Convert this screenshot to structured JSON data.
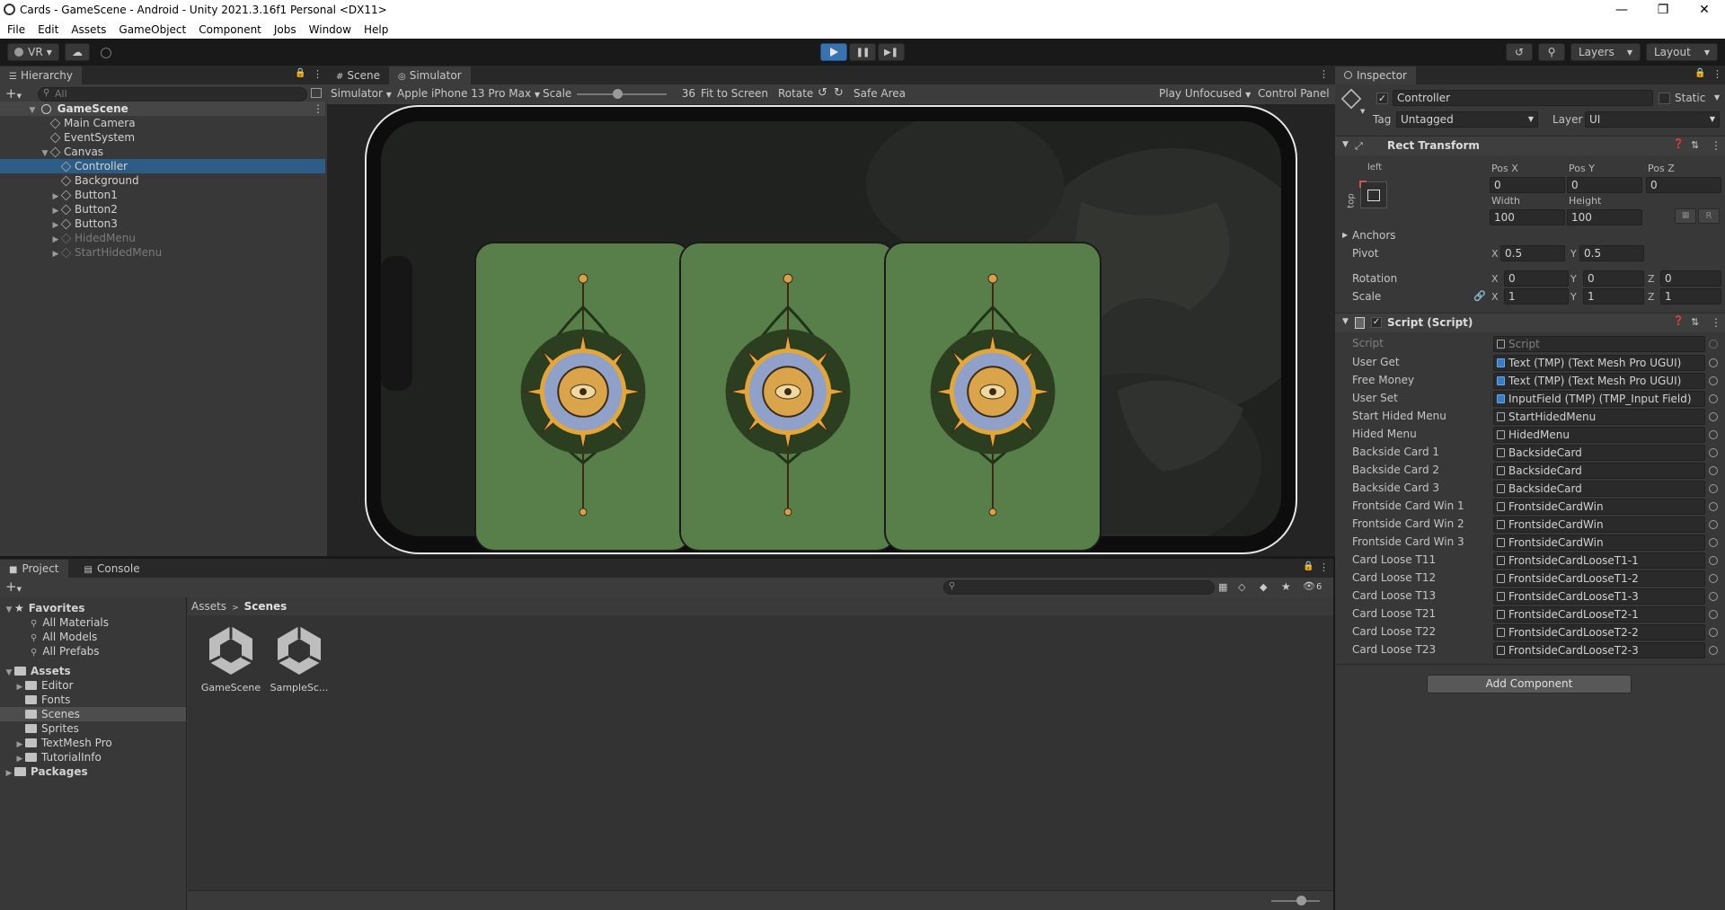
{
  "window": {
    "title": "Cards - GameScene - Android - Unity 2021.3.16f1 Personal <DX11>"
  },
  "menu": [
    "File",
    "Edit",
    "Assets",
    "GameObject",
    "Component",
    "Jobs",
    "Window",
    "Help"
  ],
  "toolbar": {
    "vr_label": "VR",
    "layers_label": "Layers",
    "layout_label": "Layout"
  },
  "hierarchy": {
    "tab": "Hierarchy",
    "search_placeholder": "All",
    "scene": "GameScene",
    "items": [
      {
        "label": "Main Camera",
        "depth": 1,
        "expandable": false,
        "selected": false,
        "dim": false
      },
      {
        "label": "EventSystem",
        "depth": 1,
        "expandable": false,
        "selected": false,
        "dim": false
      },
      {
        "label": "Canvas",
        "depth": 1,
        "expandable": true,
        "selected": false,
        "dim": false
      },
      {
        "label": "Controller",
        "depth": 2,
        "expandable": false,
        "selected": true,
        "dim": false
      },
      {
        "label": "Background",
        "depth": 2,
        "expandable": false,
        "selected": false,
        "dim": false
      },
      {
        "label": "Button1",
        "depth": 2,
        "expandable": true,
        "selected": false,
        "dim": false
      },
      {
        "label": "Button2",
        "depth": 2,
        "expandable": true,
        "selected": false,
        "dim": false
      },
      {
        "label": "Button3",
        "depth": 2,
        "expandable": true,
        "selected": false,
        "dim": false
      },
      {
        "label": "HidedMenu",
        "depth": 2,
        "expandable": true,
        "selected": false,
        "dim": true
      },
      {
        "label": "StartHidedMenu",
        "depth": 2,
        "expandable": true,
        "selected": false,
        "dim": true
      }
    ]
  },
  "scene_view": {
    "tabs": [
      "Scene",
      "Simulator"
    ],
    "simulator_label": "Simulator",
    "device": "Apple iPhone 13 Pro Max",
    "scale_label": "Scale",
    "scale_value": "36",
    "fit_label": "Fit to Screen",
    "rotate_label": "Rotate",
    "safe_area_label": "Safe Area",
    "play_unfocused_label": "Play Unfocused",
    "control_panel_label": "Control Panel",
    "scale_slider_level": 0.45
  },
  "inspector": {
    "tab": "Inspector",
    "object_name": "Controller",
    "static_label": "Static",
    "tag_label": "Tag",
    "tag_value": "Untagged",
    "layer_label": "Layer",
    "layer_value": "UI",
    "rect_transform": {
      "title": "Rect Transform",
      "anchor_h": "left",
      "anchor_v": "top",
      "posx_label": "Pos X",
      "posx": "0",
      "posy_label": "Pos Y",
      "posy": "0",
      "posz_label": "Pos Z",
      "posz": "0",
      "width_label": "Width",
      "width": "100",
      "height_label": "Height",
      "height": "100",
      "anchors_label": "Anchors",
      "pivot_label": "Pivot",
      "pivot_x": "0.5",
      "pivot_y": "0.5",
      "rotation_label": "Rotation",
      "rot_x": "0",
      "rot_y": "0",
      "rot_z": "0",
      "scale_label": "Scale",
      "scale_x": "1",
      "scale_y": "1",
      "scale_z": "1",
      "x_label": "X",
      "y_label": "Y",
      "z_label": "Z",
      "r_label": "R"
    },
    "script": {
      "title": "Script (Script)",
      "script_label": "Script",
      "script_value": "Script",
      "fields": [
        {
          "label": "User Get",
          "value": "Text (TMP) (Text Mesh Pro UGUI)",
          "kind": "tmp"
        },
        {
          "label": "Free Money",
          "value": "Text (TMP) (Text Mesh Pro UGUI)",
          "kind": "tmp"
        },
        {
          "label": "User Set",
          "value": "InputField (TMP) (TMP_Input Field)",
          "kind": "tmp"
        },
        {
          "label": "Start Hided Menu",
          "value": "StartHidedMenu",
          "kind": "obj"
        },
        {
          "label": "Hided Menu",
          "value": "HidedMenu",
          "kind": "obj"
        },
        {
          "label": "Backside Card 1",
          "value": "BacksideCard",
          "kind": "obj"
        },
        {
          "label": "Backside Card 2",
          "value": "BacksideCard",
          "kind": "obj"
        },
        {
          "label": "Backside Card 3",
          "value": "BacksideCard",
          "kind": "obj"
        },
        {
          "label": "Frontside Card Win 1",
          "value": "FrontsideCardWin",
          "kind": "obj"
        },
        {
          "label": "Frontside Card Win 2",
          "value": "FrontsideCardWin",
          "kind": "obj"
        },
        {
          "label": "Frontside Card Win 3",
          "value": "FrontsideCardWin",
          "kind": "obj"
        },
        {
          "label": "Card Loose T11",
          "value": "FrontsideCardLooseT1-1",
          "kind": "obj"
        },
        {
          "label": "Card Loose T12",
          "value": "FrontsideCardLooseT1-2",
          "kind": "obj"
        },
        {
          "label": "Card Loose T13",
          "value": "FrontsideCardLooseT1-3",
          "kind": "obj"
        },
        {
          "label": "Card Loose T21",
          "value": "FrontsideCardLooseT2-1",
          "kind": "obj"
        },
        {
          "label": "Card Loose T22",
          "value": "FrontsideCardLooseT2-2",
          "kind": "obj"
        },
        {
          "label": "Card Loose T23",
          "value": "FrontsideCardLooseT2-3",
          "kind": "obj"
        }
      ]
    },
    "add_component": "Add Component"
  },
  "project": {
    "tabs": [
      "Project",
      "Console"
    ],
    "hidden_count": "6",
    "favorites_label": "Favorites",
    "favorites": [
      "All Materials",
      "All Models",
      "All Prefabs"
    ],
    "assets_label": "Assets",
    "folders": [
      {
        "label": "Editor",
        "expandable": true,
        "selected": false
      },
      {
        "label": "Fonts",
        "expandable": false,
        "selected": false
      },
      {
        "label": "Scenes",
        "expandable": false,
        "selected": true
      },
      {
        "label": "Sprites",
        "expandable": false,
        "selected": false
      },
      {
        "label": "TextMesh Pro",
        "expandable": true,
        "selected": false
      },
      {
        "label": "TutorialInfo",
        "expandable": true,
        "selected": false
      }
    ],
    "packages_label": "Packages",
    "breadcrumb": [
      "Assets",
      "Scenes"
    ],
    "files": [
      "GameScene",
      "SampleSc..."
    ]
  },
  "colors": {
    "selection": "#2c5d87",
    "card_green": "#587f49",
    "play_blue": "#3a72b0"
  }
}
